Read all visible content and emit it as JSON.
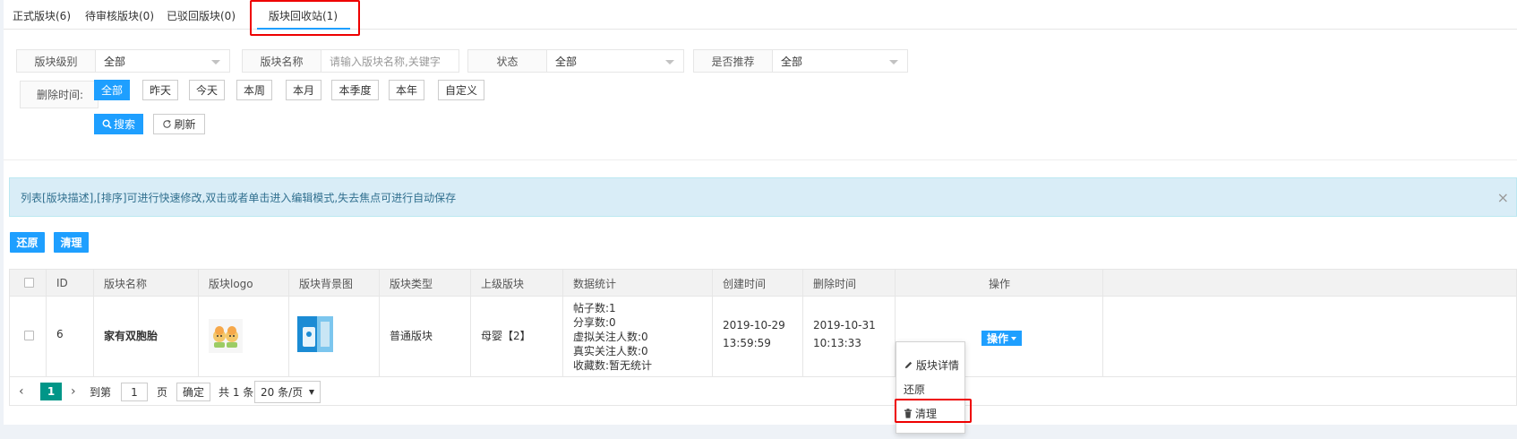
{
  "tabs": [
    {
      "label": "正式版块(6)"
    },
    {
      "label": "待审核版块(0)"
    },
    {
      "label": "已驳回版块(0)"
    },
    {
      "label": "版块回收站(1)"
    }
  ],
  "filters": {
    "level": {
      "label": "版块级别",
      "value": "全部"
    },
    "name": {
      "label": "版块名称",
      "placeholder": "请输入版块名称,关键字"
    },
    "status": {
      "label": "状态",
      "value": "全部"
    },
    "recommend": {
      "label": "是否推荐",
      "value": "全部"
    },
    "delete_time": {
      "label": "删除时间:",
      "options": [
        "全部",
        "昨天",
        "今天",
        "本周",
        "本月",
        "本季度",
        "本年",
        "自定义"
      ],
      "selected": "全部"
    },
    "search_label": "搜索",
    "refresh_label": "刷新"
  },
  "notice": {
    "text": "列表[版块描述],[排序]可进行快速修改,双击或者单击进入编辑模式,失去焦点可进行自动保存",
    "close": "×"
  },
  "actions": {
    "restore": "还原",
    "clear": "清理"
  },
  "table": {
    "headers": [
      "ID",
      "版块名称",
      "版块logo",
      "版块背景图",
      "版块类型",
      "上级版块",
      "数据统计",
      "创建时间",
      "删除时间",
      "操作"
    ],
    "rows": [
      {
        "id": "6",
        "name": "家有双胞胎",
        "type": "普通版块",
        "parent": "母婴【2】",
        "stats": [
          "帖子数:1",
          "分享数:0",
          "虚拟关注人数:0",
          "真实关注人数:0",
          "收藏数:暂无统计"
        ],
        "created_date": "2019-10-29",
        "created_time": "13:59:59",
        "deleted_date": "2019-10-31",
        "deleted_time": "10:13:33",
        "op_label": "操作"
      }
    ]
  },
  "pager": {
    "current": "1",
    "goto_prefix": "到第",
    "goto_value": "1",
    "goto_suffix": "页",
    "confirm": "确定",
    "total": "共 1 条",
    "per_page": "20 条/页"
  },
  "menu": {
    "items": [
      "版块详情",
      "还原",
      "清理"
    ]
  },
  "colors": {
    "primary": "#1e9fff",
    "page_current": "#009688",
    "highlight": "#e00000",
    "notice_bg": "#d9edf7"
  }
}
